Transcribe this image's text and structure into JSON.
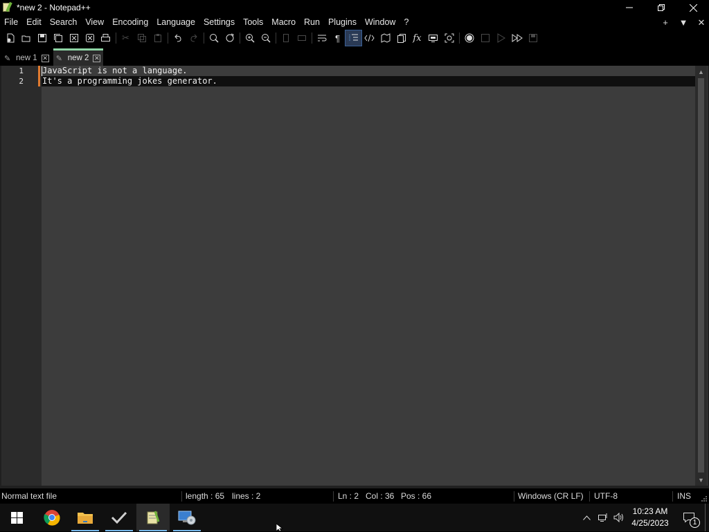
{
  "window": {
    "title": "*new 2 - Notepad++",
    "controls": [
      "minimize-icon",
      "restore-icon",
      "close-icon"
    ]
  },
  "menu": {
    "items": [
      "File",
      "Edit",
      "Search",
      "View",
      "Encoding",
      "Language",
      "Settings",
      "Tools",
      "Macro",
      "Run",
      "Plugins",
      "Window",
      "?"
    ],
    "right_icons": [
      "plus-icon",
      "dropdown-arrow-icon",
      "close-icon"
    ]
  },
  "toolbar": {
    "icons": [
      "new-file-icon",
      "open-file-icon",
      "save-icon",
      "save-all-icon",
      "close-icon",
      "close-all-icon",
      "print-icon",
      "cut-icon",
      "copy-icon",
      "paste-icon",
      "undo-icon",
      "redo-icon",
      "find-icon",
      "replace-icon",
      "zoom-in-icon",
      "zoom-out-icon",
      "sync-vertical-icon",
      "sync-horizontal-icon",
      "word-wrap-icon",
      "show-all-characters-icon",
      "indent-guide-icon",
      "language-icon",
      "document-map-icon",
      "document-list-icon",
      "function-list-icon",
      "folder-as-workspace-icon",
      "monitoring-icon",
      "record-macro-icon",
      "stop-recording-icon",
      "play-macro-icon",
      "run-macro-multiple-icon",
      "save-macro-icon"
    ]
  },
  "tabs": [
    {
      "label": "new 1",
      "active": false
    },
    {
      "label": "new 2",
      "active": true
    }
  ],
  "editor": {
    "lines": [
      {
        "number": "1",
        "text": "JavaScript is not a language."
      },
      {
        "number": "2",
        "text": "It's a programming jokes generator."
      }
    ],
    "current_line": 2
  },
  "status": {
    "file_type": "Normal text file",
    "length": "length : 65",
    "lines": "lines : 2",
    "ln": "Ln : 2",
    "col": "Col : 36",
    "pos": "Pos : 66",
    "eol": "Windows (CR LF)",
    "encoding": "UTF-8",
    "mode": "INS"
  },
  "taskbar": {
    "apps": [
      "windows-start-icon",
      "chrome-icon",
      "file-explorer-icon",
      "tasks-check-icon",
      "notepadpp-icon",
      "network-settings-icon"
    ],
    "active_app": "notepadpp-icon",
    "time": "10:23 AM",
    "date": "4/25/2023",
    "notifications": "1"
  },
  "colors": {
    "editor_bg": "#3c3c3c",
    "gutter_bg": "#2b2b2b",
    "current_line_bg": "#0f0f0f",
    "change_marker": "#e07a2f",
    "active_tab_accent": "#8fd6a6"
  }
}
